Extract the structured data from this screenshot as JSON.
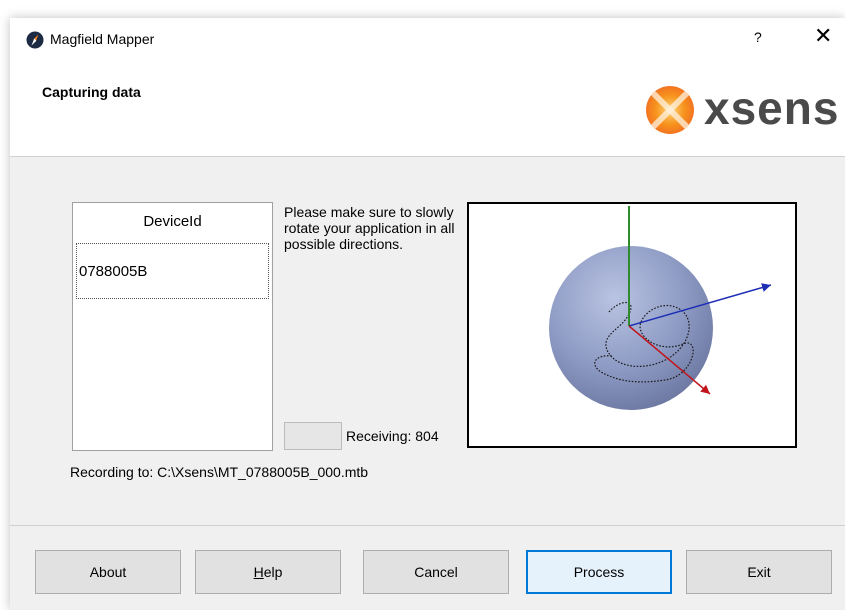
{
  "window": {
    "title": "Magfield Mapper",
    "help_glyph": "?",
    "close_glyph": "✕"
  },
  "header": {
    "step_title": "Capturing data",
    "brand_text": "xsens",
    "accent_color": "#f58220"
  },
  "device_table": {
    "column_header": "DeviceId",
    "rows": [
      "0788005B"
    ]
  },
  "instructions": "Please make sure to slowly rotate your application in all possible directions.",
  "status": {
    "receiving": "Receiving: 804",
    "recording": "Recording to: C:\\Xsens\\MT_0788005B_000.mtb"
  },
  "viewport": {
    "axis_colors": {
      "x": "#1e2fb5",
      "y": "#2e8b2e",
      "z": "#c0141a"
    },
    "sphere_color": "#8e9bc4"
  },
  "buttons": {
    "about": "About",
    "help_mnemonic": "H",
    "help_rest": "elp",
    "cancel": "Cancel",
    "process": "Process",
    "exit": "Exit"
  },
  "icons": {
    "app": "compass-icon",
    "close": "close-icon",
    "help": "help-icon",
    "brand": "xsens-logo-icon"
  }
}
